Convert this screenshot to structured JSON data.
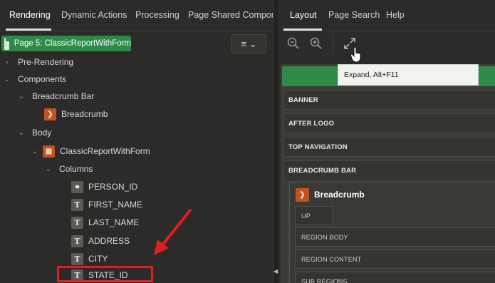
{
  "left_tabs": [
    "Rendering",
    "Dynamic Actions",
    "Processing",
    "Page Shared Componen"
  ],
  "page_chip": "Page 5: ClassicReportWithForm",
  "menu_button": "≡ ⌄",
  "tree": {
    "pre_rendering": "Pre-Rendering",
    "components": "Components",
    "breadcrumb_bar": "Breadcrumb Bar",
    "breadcrumb": "Breadcrumb",
    "body": "Body",
    "report": "ClassicReportWithForm",
    "columns": "Columns",
    "cols": [
      "PERSON_ID",
      "FIRST_NAME",
      "LAST_NAME",
      "ADDRESS",
      "CITY",
      "STATE_ID"
    ]
  },
  "right_tabs": [
    "Layout",
    "Page Search",
    "Help"
  ],
  "tooltip": "Expand, Alt+F11",
  "positions": [
    "BANNER",
    "AFTER LOGO",
    "TOP NAVIGATION",
    "BREADCRUMB BAR"
  ],
  "region_title": "Breadcrumb",
  "slots": [
    "UP",
    "REGION BODY",
    "REGION CONTENT",
    "SUB REGIONS"
  ],
  "colors": {
    "page_green": "#2f8a4a",
    "highlight_red": "#e0201c",
    "component_orange": "#c0541f"
  }
}
